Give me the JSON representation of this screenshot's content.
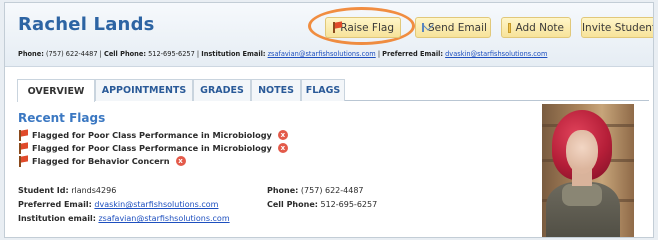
{
  "student": {
    "name": "Rachel Lands",
    "phone_label": "Phone:",
    "phone": "(757) 622-4487",
    "cell_label": "Cell Phone:",
    "cell": "512-695-6257",
    "inst_email_label": "Institution Email:",
    "inst_email": "zsafavian@starfishsolutions.com",
    "pref_email_label": "Preferred Email:",
    "pref_email": "dvaskin@starfishsolutions.com",
    "id_label": "Student Id:",
    "id": "rlands4296",
    "inst_email_label2": "Institution email:"
  },
  "actions": {
    "raise_flag": "Raise Flag",
    "send_email": "Send Email",
    "add_note": "Add Note",
    "invite_student": "Invite Student"
  },
  "tabs": [
    "OVERVIEW",
    "APPOINTMENTS",
    "GRADES",
    "NOTES",
    "FLAGS"
  ],
  "recent_flags": {
    "title": "Recent Flags",
    "items": [
      "Flagged for Poor Class Performance in Microbiology",
      "Flagged for Poor Class Performance in Microbiology",
      "Flagged for Behavior Concern"
    ],
    "remove_glyph": "x"
  },
  "colors": {
    "accent": "#2d64a3",
    "highlight_ring": "#f07a20",
    "button_bg": "#f7e39a",
    "link": "#1d4fbf"
  },
  "icons": {
    "raise_flag": "flag-icon",
    "send_email": "envelope-icon",
    "add_note": "note-icon",
    "remove_flag": "remove-icon"
  }
}
